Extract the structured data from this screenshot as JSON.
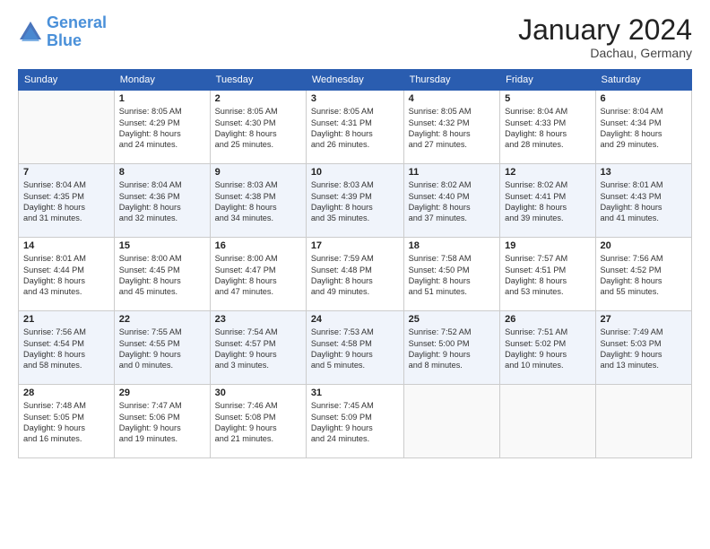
{
  "header": {
    "logo_line1": "General",
    "logo_line2": "Blue",
    "month_title": "January 2024",
    "location": "Dachau, Germany"
  },
  "days_of_week": [
    "Sunday",
    "Monday",
    "Tuesday",
    "Wednesday",
    "Thursday",
    "Friday",
    "Saturday"
  ],
  "weeks": [
    [
      {
        "day": "",
        "info": ""
      },
      {
        "day": "1",
        "info": "Sunrise: 8:05 AM\nSunset: 4:29 PM\nDaylight: 8 hours\nand 24 minutes."
      },
      {
        "day": "2",
        "info": "Sunrise: 8:05 AM\nSunset: 4:30 PM\nDaylight: 8 hours\nand 25 minutes."
      },
      {
        "day": "3",
        "info": "Sunrise: 8:05 AM\nSunset: 4:31 PM\nDaylight: 8 hours\nand 26 minutes."
      },
      {
        "day": "4",
        "info": "Sunrise: 8:05 AM\nSunset: 4:32 PM\nDaylight: 8 hours\nand 27 minutes."
      },
      {
        "day": "5",
        "info": "Sunrise: 8:04 AM\nSunset: 4:33 PM\nDaylight: 8 hours\nand 28 minutes."
      },
      {
        "day": "6",
        "info": "Sunrise: 8:04 AM\nSunset: 4:34 PM\nDaylight: 8 hours\nand 29 minutes."
      }
    ],
    [
      {
        "day": "7",
        "info": "Sunrise: 8:04 AM\nSunset: 4:35 PM\nDaylight: 8 hours\nand 31 minutes."
      },
      {
        "day": "8",
        "info": "Sunrise: 8:04 AM\nSunset: 4:36 PM\nDaylight: 8 hours\nand 32 minutes."
      },
      {
        "day": "9",
        "info": "Sunrise: 8:03 AM\nSunset: 4:38 PM\nDaylight: 8 hours\nand 34 minutes."
      },
      {
        "day": "10",
        "info": "Sunrise: 8:03 AM\nSunset: 4:39 PM\nDaylight: 8 hours\nand 35 minutes."
      },
      {
        "day": "11",
        "info": "Sunrise: 8:02 AM\nSunset: 4:40 PM\nDaylight: 8 hours\nand 37 minutes."
      },
      {
        "day": "12",
        "info": "Sunrise: 8:02 AM\nSunset: 4:41 PM\nDaylight: 8 hours\nand 39 minutes."
      },
      {
        "day": "13",
        "info": "Sunrise: 8:01 AM\nSunset: 4:43 PM\nDaylight: 8 hours\nand 41 minutes."
      }
    ],
    [
      {
        "day": "14",
        "info": "Sunrise: 8:01 AM\nSunset: 4:44 PM\nDaylight: 8 hours\nand 43 minutes."
      },
      {
        "day": "15",
        "info": "Sunrise: 8:00 AM\nSunset: 4:45 PM\nDaylight: 8 hours\nand 45 minutes."
      },
      {
        "day": "16",
        "info": "Sunrise: 8:00 AM\nSunset: 4:47 PM\nDaylight: 8 hours\nand 47 minutes."
      },
      {
        "day": "17",
        "info": "Sunrise: 7:59 AM\nSunset: 4:48 PM\nDaylight: 8 hours\nand 49 minutes."
      },
      {
        "day": "18",
        "info": "Sunrise: 7:58 AM\nSunset: 4:50 PM\nDaylight: 8 hours\nand 51 minutes."
      },
      {
        "day": "19",
        "info": "Sunrise: 7:57 AM\nSunset: 4:51 PM\nDaylight: 8 hours\nand 53 minutes."
      },
      {
        "day": "20",
        "info": "Sunrise: 7:56 AM\nSunset: 4:52 PM\nDaylight: 8 hours\nand 55 minutes."
      }
    ],
    [
      {
        "day": "21",
        "info": "Sunrise: 7:56 AM\nSunset: 4:54 PM\nDaylight: 8 hours\nand 58 minutes."
      },
      {
        "day": "22",
        "info": "Sunrise: 7:55 AM\nSunset: 4:55 PM\nDaylight: 9 hours\nand 0 minutes."
      },
      {
        "day": "23",
        "info": "Sunrise: 7:54 AM\nSunset: 4:57 PM\nDaylight: 9 hours\nand 3 minutes."
      },
      {
        "day": "24",
        "info": "Sunrise: 7:53 AM\nSunset: 4:58 PM\nDaylight: 9 hours\nand 5 minutes."
      },
      {
        "day": "25",
        "info": "Sunrise: 7:52 AM\nSunset: 5:00 PM\nDaylight: 9 hours\nand 8 minutes."
      },
      {
        "day": "26",
        "info": "Sunrise: 7:51 AM\nSunset: 5:02 PM\nDaylight: 9 hours\nand 10 minutes."
      },
      {
        "day": "27",
        "info": "Sunrise: 7:49 AM\nSunset: 5:03 PM\nDaylight: 9 hours\nand 13 minutes."
      }
    ],
    [
      {
        "day": "28",
        "info": "Sunrise: 7:48 AM\nSunset: 5:05 PM\nDaylight: 9 hours\nand 16 minutes."
      },
      {
        "day": "29",
        "info": "Sunrise: 7:47 AM\nSunset: 5:06 PM\nDaylight: 9 hours\nand 19 minutes."
      },
      {
        "day": "30",
        "info": "Sunrise: 7:46 AM\nSunset: 5:08 PM\nDaylight: 9 hours\nand 21 minutes."
      },
      {
        "day": "31",
        "info": "Sunrise: 7:45 AM\nSunset: 5:09 PM\nDaylight: 9 hours\nand 24 minutes."
      },
      {
        "day": "",
        "info": ""
      },
      {
        "day": "",
        "info": ""
      },
      {
        "day": "",
        "info": ""
      }
    ]
  ]
}
